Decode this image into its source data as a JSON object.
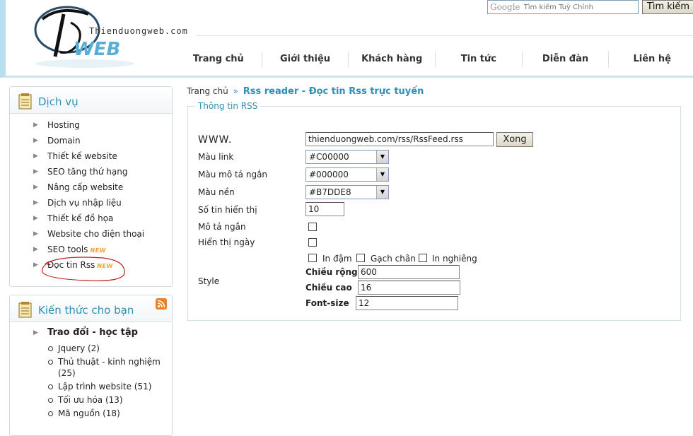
{
  "header": {
    "logo_text": "Thienduongweb.com",
    "logo_letters": "WEB",
    "search": {
      "brand": "Google",
      "placeholder": "Tìm kiếm Tuỳ Chỉnh",
      "button_label": "Tìm kiếm"
    },
    "nav": [
      "Trang chủ",
      "Giới thiệu",
      "Khách hàng",
      "Tin tức",
      "Diễn đàn",
      "Liên hệ"
    ]
  },
  "sidebar": {
    "services": {
      "title": "Dịch vụ",
      "items": [
        {
          "label": "Hosting",
          "new": ""
        },
        {
          "label": "Domain",
          "new": ""
        },
        {
          "label": "Thiết kế website",
          "new": ""
        },
        {
          "label": "SEO tăng thứ hạng",
          "new": ""
        },
        {
          "label": "Nâng cấp website",
          "new": ""
        },
        {
          "label": "Dịch vụ nhập liệu",
          "new": ""
        },
        {
          "label": "Thiết kế đồ họa",
          "new": ""
        },
        {
          "label": "Website cho điện thoại",
          "new": ""
        },
        {
          "label": "SEO tools",
          "new": "NEW"
        },
        {
          "label": "Đọc tin Rss",
          "new": "NEW"
        }
      ]
    },
    "knowledge": {
      "title": "Kiến thức cho bạn",
      "group": "Trao đổi - học tập",
      "items": [
        "Jquery (2)",
        "Thủ thuật - kinh nghiệm (25)",
        "Lập trình website (51)",
        "Tối ưu hóa (13)",
        "Mã nguồn (18)"
      ]
    }
  },
  "main": {
    "breadcrumb": {
      "home": "Trang chủ",
      "sep": "»",
      "current": "Rss reader - Đọc tin Rss trực tuyến"
    },
    "legend": "Thông tin RSS",
    "form": {
      "www_label": "WWW.",
      "www_value": "thienduongweb.com/rss/RssFeed.rss",
      "submit_label": "Xong",
      "link_color_label": "Màu link",
      "link_color": "#C00000",
      "desc_color_label": "Màu mô tả ngắn",
      "desc_color": "#000000",
      "bg_color_label": "Màu nền",
      "bg_color": "#B7DDE8",
      "count_label": "Số tin hiển thị",
      "count_value": "10",
      "short_desc_label": "Mô tả ngắn",
      "show_date_label": "Hiển thị ngày",
      "style_label": "Style",
      "bold_label": "In đậm",
      "underline_label": "Gạch chân",
      "italic_label": "In nghiêng",
      "width_label": "Chiều rộng",
      "width_value": "600",
      "height_label": "Chiều cao",
      "height_value": "16",
      "fontsize_label": "Font-size",
      "fontsize_value": "12"
    }
  }
}
